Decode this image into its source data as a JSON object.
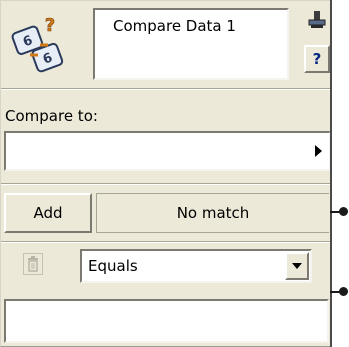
{
  "node": {
    "title": "Compare Data 1",
    "icon": "compare-data-icon",
    "pin_icon": "pin-icon",
    "help_label": "?"
  },
  "compare": {
    "label": "Compare to:",
    "value": "",
    "expand_icon": "arrow-right-icon"
  },
  "actions": {
    "add_label": "Add",
    "status": "No match"
  },
  "condition": {
    "delete_icon": "trash-icon",
    "selected": "Equals",
    "dropdown_icon": "chevron-down-icon",
    "value": ""
  }
}
